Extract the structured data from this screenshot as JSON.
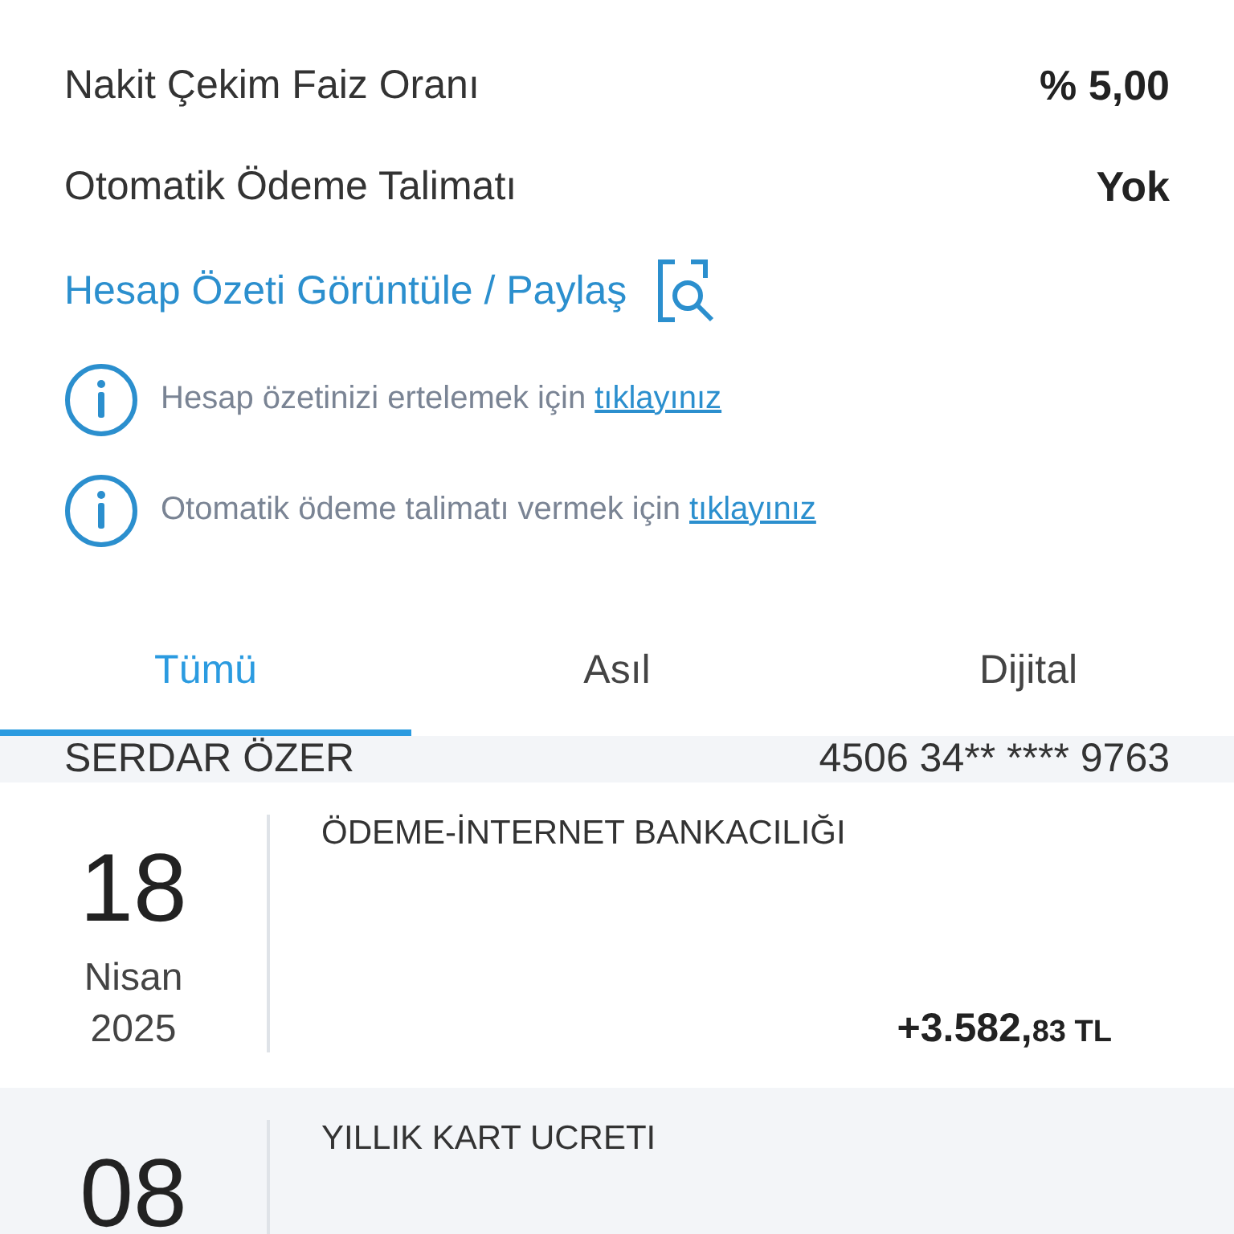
{
  "details": [
    {
      "label": "Nakit Çekim Faiz Oranı",
      "value": "% 5,00"
    },
    {
      "label": "Otomatik Ödeme Talimatı",
      "value": "Yok"
    }
  ],
  "statement_link": {
    "label": "Hesap Özeti Görüntüle / Paylaş"
  },
  "notices": [
    {
      "text": "Hesap özetinizi ertelemek için",
      "link": "tıklayınız"
    },
    {
      "text": "Otomatik ödeme talimatı vermek için",
      "link": "tıklayınız"
    }
  ],
  "tabs": [
    {
      "label": "Tümü",
      "selected": true
    },
    {
      "label": "Asıl",
      "selected": false
    },
    {
      "label": "Dijital",
      "selected": false
    }
  ],
  "card": {
    "holder": "SERDAR ÖZER",
    "number": "4506 34** **** 9763"
  },
  "transactions": [
    {
      "day": "18",
      "month": "Nisan",
      "year": "2025",
      "description": "ÖDEME-İNTERNET BANKACILIĞI",
      "amount_main": "+3.582,",
      "amount_cents": "83",
      "currency": "TL"
    },
    {
      "day": "08",
      "description": "YILLIK KART UCRETI"
    }
  ]
}
